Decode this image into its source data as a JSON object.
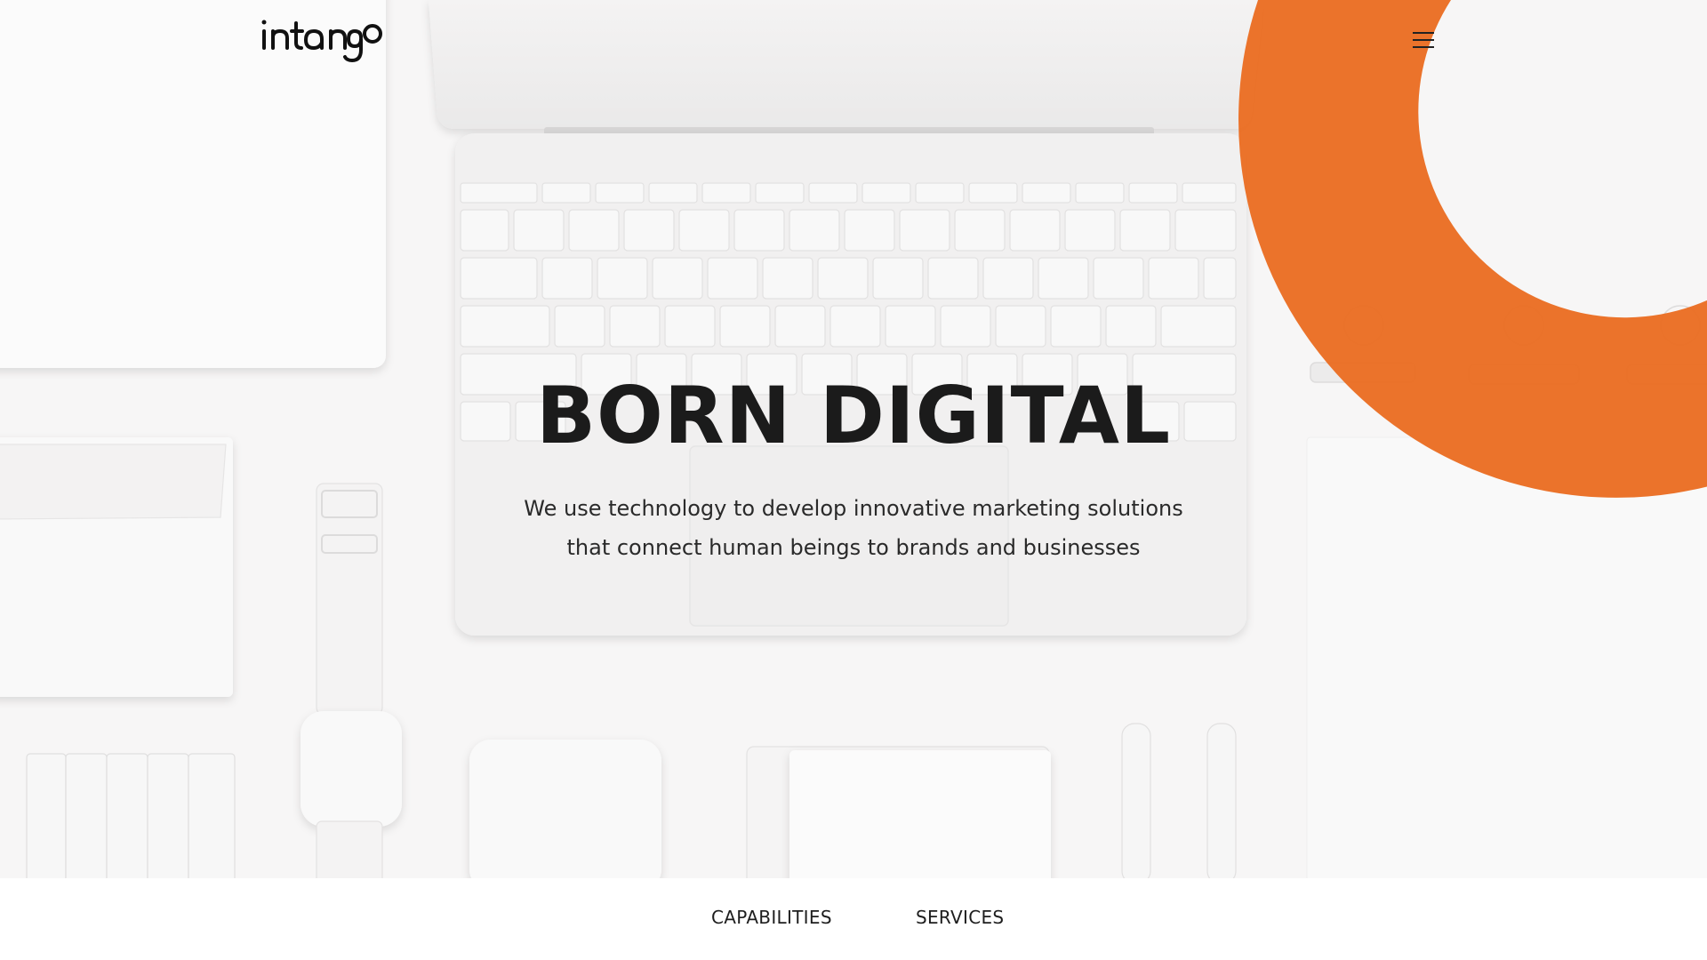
{
  "brand": {
    "logo_text": "intango",
    "accent_color": "#ea6d22"
  },
  "header": {
    "menu_icon": "hamburger-menu-icon"
  },
  "hero": {
    "title": "BORN DIGITAL",
    "subtitle_line1": "We use technology to develop innovative marketing solutions",
    "subtitle_line2": "that connect human beings to brands and businesses"
  },
  "bottom_nav": {
    "items": [
      {
        "label": "CAPABILITIES"
      },
      {
        "label": "SERVICES"
      }
    ]
  }
}
